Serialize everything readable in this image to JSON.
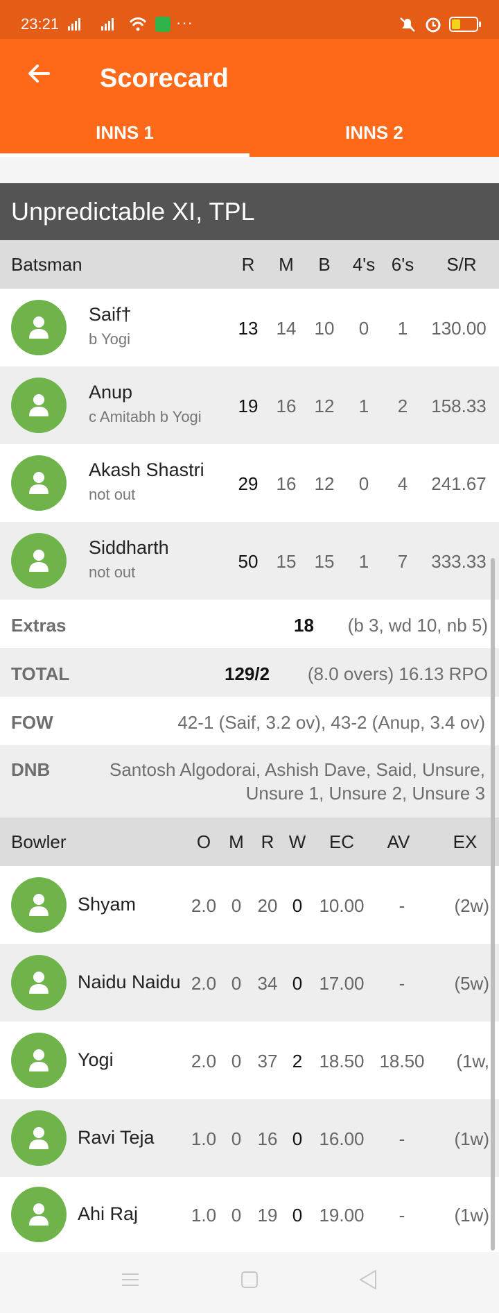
{
  "status_bar": {
    "time": "23:21",
    "dots": "···"
  },
  "app_bar": {
    "title": "Scorecard",
    "back_icon": "arrow-left-icon"
  },
  "tabs": [
    {
      "label": "INNS 1"
    },
    {
      "label": "INNS 2"
    }
  ],
  "team_name": "Unpredictable XI, TPL",
  "batting_header": {
    "batsman": "Batsman",
    "r": "R",
    "m": "M",
    "b": "B",
    "fours": "4's",
    "sixes": "6's",
    "sr": "S/R"
  },
  "batsmen": [
    {
      "name": "Saif†",
      "dismissal": "b Yogi",
      "r": "13",
      "m": "14",
      "b": "10",
      "fours": "0",
      "sixes": "1",
      "sr": "130.00"
    },
    {
      "name": "Anup",
      "dismissal": "c Amitabh b Yogi",
      "r": "19",
      "m": "16",
      "b": "12",
      "fours": "1",
      "sixes": "2",
      "sr": "158.33"
    },
    {
      "name": "Akash Shastri",
      "dismissal": "not out",
      "r": "29",
      "m": "16",
      "b": "12",
      "fours": "0",
      "sixes": "4",
      "sr": "241.67"
    },
    {
      "name": "Siddharth",
      "dismissal": "not out",
      "r": "50",
      "m": "15",
      "b": "15",
      "fours": "1",
      "sixes": "7",
      "sr": "333.33"
    }
  ],
  "extras": {
    "label": "Extras",
    "value": "18",
    "detail": "(b 3, wd 10, nb 5)"
  },
  "total": {
    "label": "TOTAL",
    "value": "129/2",
    "detail": "(8.0 overs) 16.13 RPO"
  },
  "fow": {
    "label": "FOW",
    "value": "42-1 (Saif, 3.2 ov), 43-2 (Anup, 3.4 ov)"
  },
  "dnb": {
    "label": "DNB",
    "line1": "Santosh Algodorai, Ashish Dave, Said, Unsure,",
    "line2": "Unsure 1, Unsure 2, Unsure 3"
  },
  "bowling_header": {
    "bowler": "Bowler",
    "o": "O",
    "m": "M",
    "r": "R",
    "w": "W",
    "ec": "EC",
    "av": "AV",
    "ex": "EX"
  },
  "bowlers": [
    {
      "name": "Shyam",
      "o": "2.0",
      "m": "0",
      "r": "20",
      "w": "0",
      "ec": "10.00",
      "av": "-",
      "ex": "(2w)"
    },
    {
      "name": "Naidu Naidu",
      "o": "2.0",
      "m": "0",
      "r": "34",
      "w": "0",
      "ec": "17.00",
      "av": "-",
      "ex": "(5w)"
    },
    {
      "name": "Yogi",
      "o": "2.0",
      "m": "0",
      "r": "37",
      "w": "2",
      "ec": "18.50",
      "av": "18.50",
      "ex": "(1w,"
    },
    {
      "name": "Ravi Teja",
      "o": "1.0",
      "m": "0",
      "r": "16",
      "w": "0",
      "ec": "16.00",
      "av": "-",
      "ex": "(1w)"
    },
    {
      "name": "Ahi Raj",
      "o": "1.0",
      "m": "0",
      "r": "19",
      "w": "0",
      "ec": "19.00",
      "av": "-",
      "ex": "(1w)"
    }
  ],
  "colors": {
    "accent": "#ff6a1a",
    "status": "#e45c16",
    "avatar": "#6fb34a",
    "team_bar": "#545454"
  }
}
